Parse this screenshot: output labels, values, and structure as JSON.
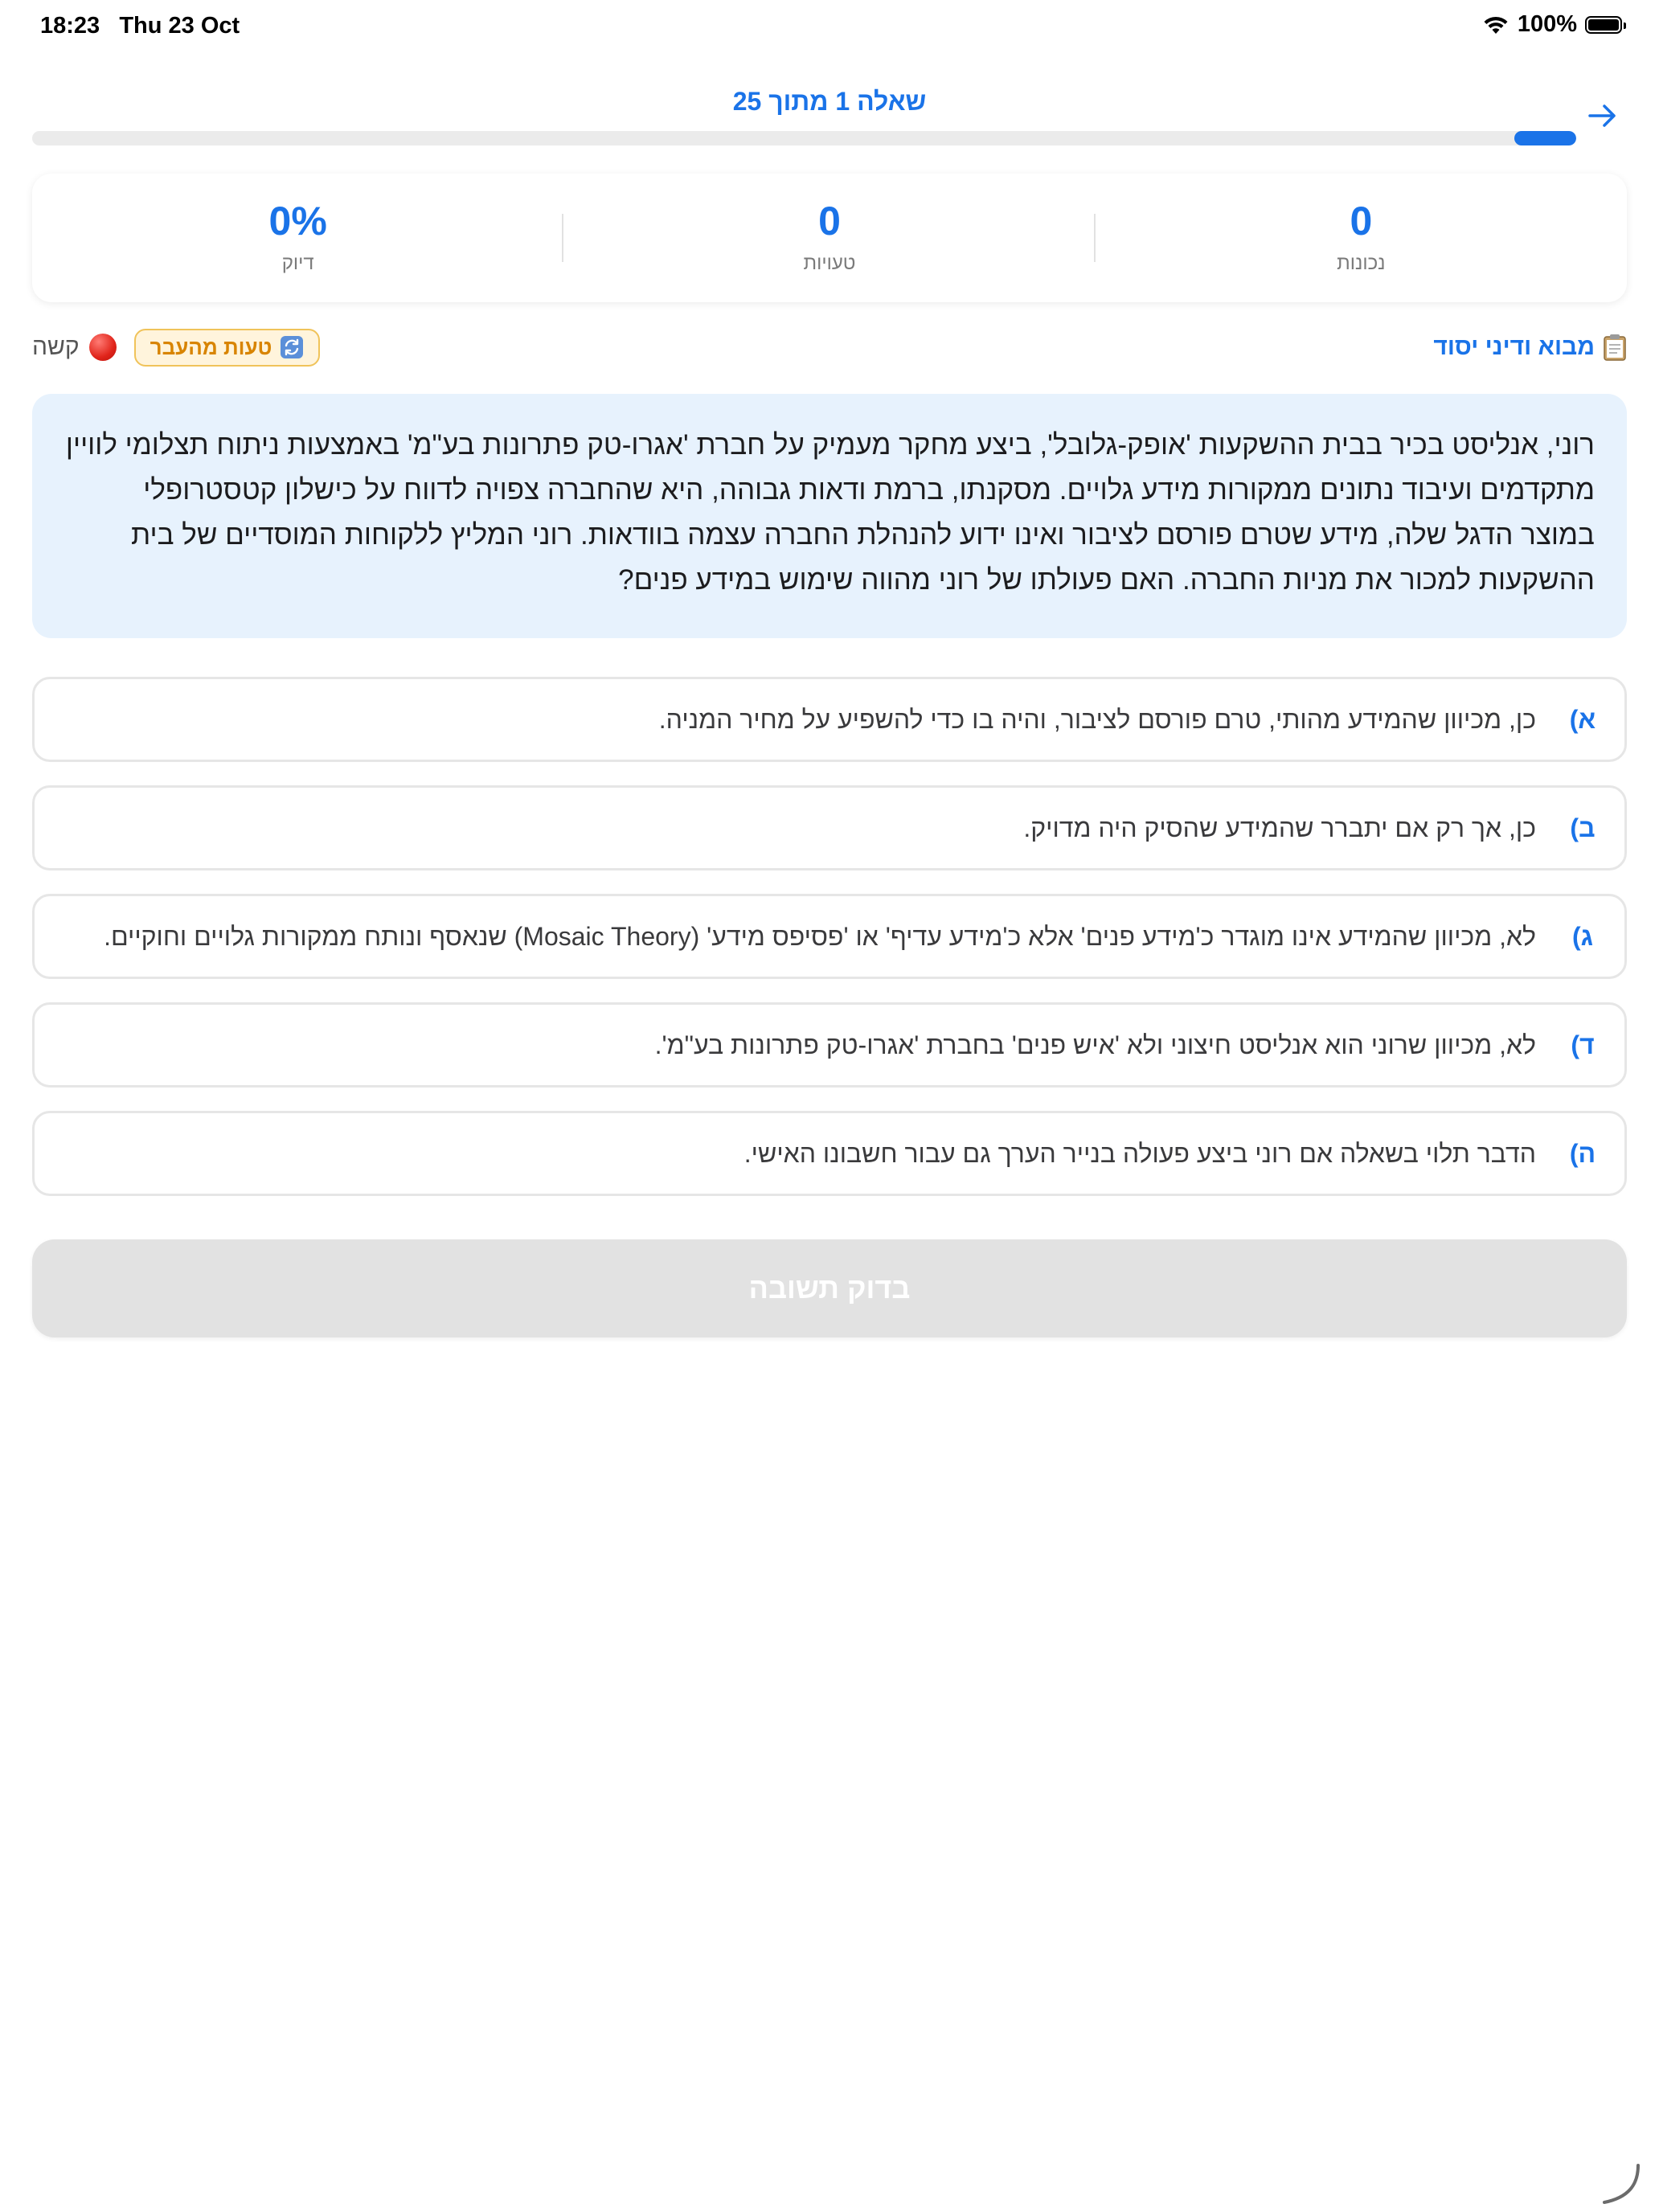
{
  "status_bar": {
    "time": "18:23",
    "date": "Thu 23 Oct",
    "battery": "100%"
  },
  "header": {
    "title": "שאלה 1 מתוך 25",
    "progress": 0.04
  },
  "stats": {
    "correct": {
      "value": "0",
      "label": "נכונות"
    },
    "mistakes": {
      "value": "0",
      "label": "טעויות"
    },
    "accuracy": {
      "value": "0%",
      "label": "דיוק"
    }
  },
  "meta": {
    "topic": "מבוא ודיני יסוד",
    "past_mistake_badge": "טעות מהעבר",
    "difficulty": "קשה"
  },
  "question": {
    "text": "רוני, אנליסט בכיר בבית ההשקעות 'אופק-גלובל', ביצע מחקר מעמיק על חברת 'אגרו-טק פתרונות בע\"מ' באמצעות ניתוח תצלומי לוויין מתקדמים ועיבוד נתונים ממקורות מידע גלויים. מסקנתו, ברמת ודאות גבוהה, היא שהחברה צפויה לדווח על כישלון קטסטרופלי במוצר הדגל שלה, מידע שטרם פורסם לציבור ואינו ידוע להנהלת החברה עצמה בוודאות. רוני המליץ ללקוחות המוסדיים של בית ההשקעות למכור את מניות החברה. האם פעולתו של רוני מהווה שימוש במידע פנים?"
  },
  "options": [
    {
      "letter": "א)",
      "text": "כן, מכיוון שהמידע מהותי, טרם פורסם לציבור, והיה בו כדי להשפיע על מחיר המניה."
    },
    {
      "letter": "ב)",
      "text": "כן, אך רק אם יתברר שהמידע שהסיק היה מדויק."
    },
    {
      "letter": "ג)",
      "text": "לא, מכיוון שהמידע אינו מוגדר כ'מידע פנים' אלא כ'מידע עדיף' או 'פסיפס מידע' (Mosaic Theory) שנאסף ונותח ממקורות גלויים וחוקיים."
    },
    {
      "letter": "ד)",
      "text": "לא, מכיוון שרוני הוא אנליסט חיצוני ולא 'איש פנים' בחברת 'אגרו-טק פתרונות בע\"מ'."
    },
    {
      "letter": "ה)",
      "text": "הדבר תלוי בשאלה אם רוני ביצע פעולה בנייר הערך גם עבור חשבונו האישי."
    }
  ],
  "submit": {
    "label": "בדוק תשובה"
  },
  "icons": {
    "back": "arrow-right-icon",
    "topic": "clipboard-icon",
    "badge": "refresh-icon",
    "difficulty": "red-circle-icon"
  },
  "colors": {
    "accent": "#1a73e8",
    "question_bg": "#e7f2fd",
    "badge_bg": "#fff4dc",
    "badge_text": "#d88400"
  }
}
